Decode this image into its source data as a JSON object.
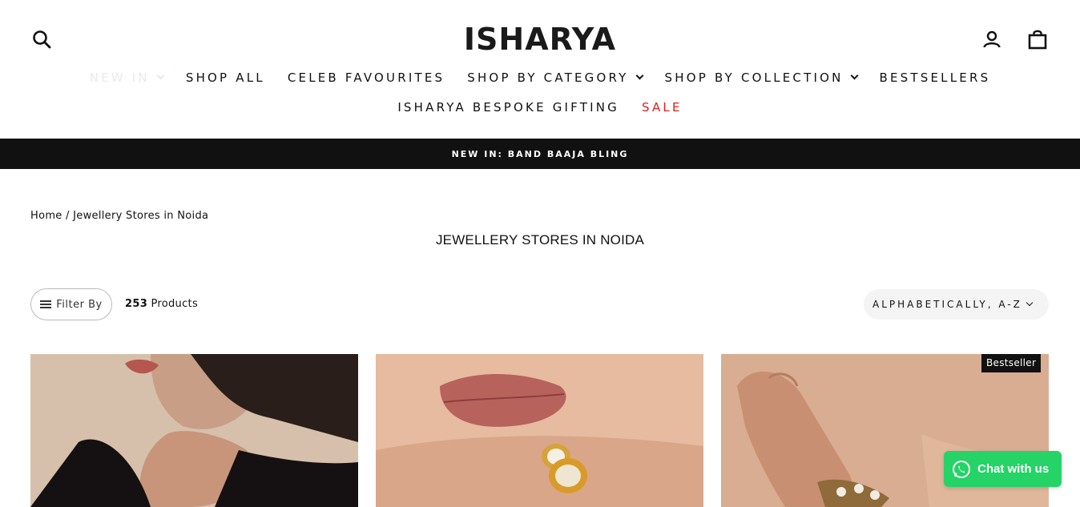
{
  "header": {
    "logo": "ISHARYA",
    "nav_row1": [
      {
        "label": "NEW IN",
        "dropdown": true,
        "style": "faded"
      },
      {
        "label": "SHOP ALL",
        "dropdown": false
      },
      {
        "label": "CELEB FAVOURITES",
        "dropdown": false
      },
      {
        "label": "SHOP BY CATEGORY",
        "dropdown": true
      },
      {
        "label": "SHOP BY COLLECTION",
        "dropdown": true
      },
      {
        "label": "BESTSELLERS",
        "dropdown": false
      }
    ],
    "nav_row2": [
      {
        "label": "ISHARYA BESPOKE GIFTING",
        "dropdown": false
      },
      {
        "label": "SALE",
        "dropdown": false,
        "style": "sale"
      }
    ],
    "icons": [
      "search-icon",
      "account-icon",
      "cart-icon"
    ]
  },
  "announcement": "NEW IN: BAND BAAJA BLING",
  "breadcrumb": {
    "home": "Home",
    "separator": "/",
    "current": "Jewellery Stores in Noida"
  },
  "page_title": "JEWELLERY STORES IN NOIDA",
  "toolbar": {
    "filter_label": "Filter By",
    "product_count": "253",
    "product_count_suffix": "Products",
    "sort_label": "ALPHABETICALLY, A-Z"
  },
  "products": [
    {
      "badge": ""
    },
    {
      "badge": ""
    },
    {
      "badge": "Bestseller"
    }
  ],
  "chat": {
    "label": "Chat with us"
  },
  "colors": {
    "announcement_bg": "#111111",
    "sale": "#e01e1e",
    "chat_bg": "#25d366",
    "new_in_faded": "#f1e7e7"
  }
}
